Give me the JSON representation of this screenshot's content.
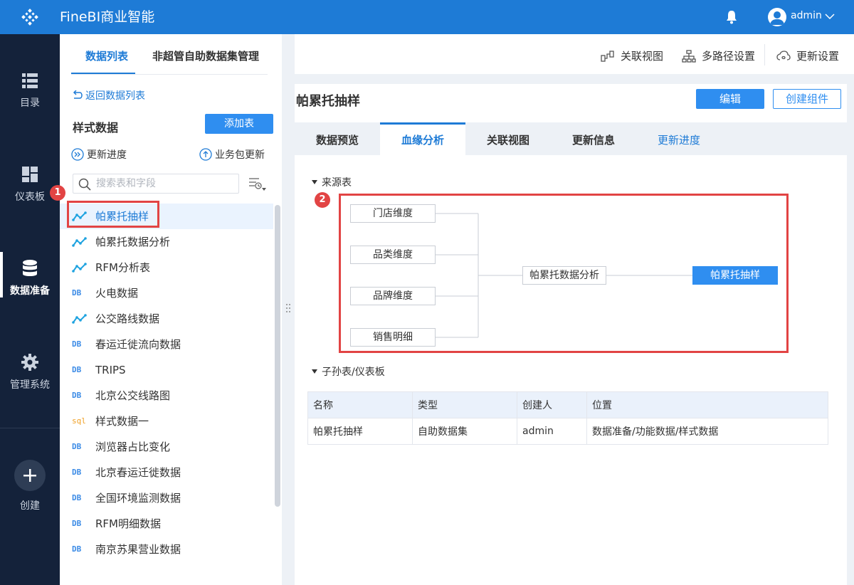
{
  "app": {
    "title": "FineBI商业智能",
    "logo_icon": "diamond-logo-icon"
  },
  "user": {
    "name": "admin"
  },
  "colors": {
    "brand": "#1e7bd6",
    "accent": "#2f8ef0",
    "nav_bg": "#14223a",
    "highlight": "#e24444"
  },
  "nav": {
    "items": [
      {
        "label": "目录",
        "icon": "list-icon"
      },
      {
        "label": "仪表板",
        "icon": "dashboard-icon"
      },
      {
        "label": "数据准备",
        "icon": "database-icon"
      },
      {
        "label": "管理系统",
        "icon": "gear-icon"
      }
    ],
    "create_label": "创建"
  },
  "left_panel": {
    "tabs": [
      "数据列表",
      "非超管自助数据集管理"
    ],
    "back_label": "返回数据列表",
    "package_title": "样式数据",
    "add_table_label": "添加表",
    "update_progress_label": "更新进度",
    "package_update_label": "业务包更新",
    "search_placeholder": "搜索表和字段",
    "items": [
      {
        "label": "帕累托抽样",
        "type": "self-dataset",
        "icon_text": "",
        "selected": true
      },
      {
        "label": "帕累托数据分析",
        "type": "self-dataset",
        "icon_text": ""
      },
      {
        "label": "RFM分析表",
        "type": "self-dataset",
        "icon_text": ""
      },
      {
        "label": "火电数据",
        "type": "db",
        "icon_text": "DB"
      },
      {
        "label": "公交路线数据",
        "type": "self-dataset",
        "icon_text": ""
      },
      {
        "label": "春运迁徙流向数据",
        "type": "db",
        "icon_text": "DB"
      },
      {
        "label": "TRIPS",
        "type": "db",
        "icon_text": "DB"
      },
      {
        "label": "北京公交线路图",
        "type": "db",
        "icon_text": "DB"
      },
      {
        "label": "样式数据一",
        "type": "sql",
        "icon_text": "sql"
      },
      {
        "label": "浏览器占比变化",
        "type": "db",
        "icon_text": "DB"
      },
      {
        "label": "北京春运迁徙数据",
        "type": "db",
        "icon_text": "DB"
      },
      {
        "label": "全国环境监测数据",
        "type": "db",
        "icon_text": "DB"
      },
      {
        "label": "RFM明细数据",
        "type": "db",
        "icon_text": "DB"
      },
      {
        "label": "南京苏果营业数据",
        "type": "db",
        "icon_text": "DB"
      }
    ]
  },
  "top_actions": {
    "relation_view": "关联视图",
    "multipath": "多路径设置",
    "update_settings": "更新设置"
  },
  "main": {
    "title": "帕累托抽样",
    "edit_label": "编辑",
    "create_component_label": "创建组件",
    "tabs": [
      "数据预览",
      "血缘分析",
      "关联视图",
      "更新信息",
      "更新进度"
    ],
    "active_tab": "血缘分析",
    "source_section": "来源表",
    "child_section": "子孙表/仪表板",
    "lineage": {
      "sources": [
        "门店维度",
        "品类维度",
        "品牌维度",
        "销售明细"
      ],
      "intermediate": "帕累托数据分析",
      "target": "帕累托抽样"
    },
    "child_table": {
      "headers": [
        "名称",
        "类型",
        "创建人",
        "位置"
      ],
      "rows": [
        [
          "帕累托抽样",
          "自助数据集",
          "admin",
          "数据准备/功能数据/样式数据"
        ]
      ]
    }
  },
  "badges": [
    "1",
    "2"
  ]
}
